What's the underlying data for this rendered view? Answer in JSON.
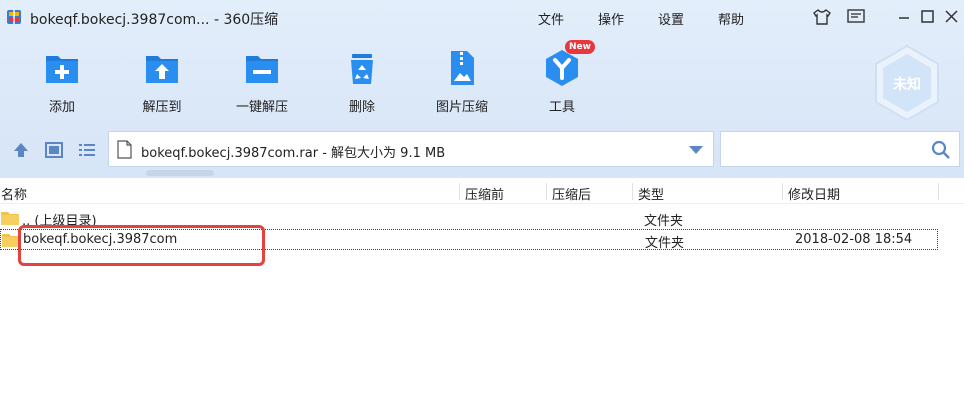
{
  "window": {
    "title": "bokeqf.bokecj.3987com... - 360压缩",
    "menu": [
      "文件",
      "操作",
      "设置",
      "帮助"
    ]
  },
  "toolbar": {
    "items": [
      {
        "label": "添加",
        "icon": "add-icon"
      },
      {
        "label": "解压到",
        "icon": "extract-to-icon"
      },
      {
        "label": "一键解压",
        "icon": "one-click-extract-icon"
      },
      {
        "label": "删除",
        "icon": "delete-icon"
      },
      {
        "label": "图片压缩",
        "icon": "image-compress-icon"
      },
      {
        "label": "工具",
        "icon": "tools-icon"
      }
    ],
    "new_badge": "New",
    "unknown_label": "未知"
  },
  "address": {
    "text": "bokeqf.bokecj.3987com.rar - 解包大小为 9.1 MB",
    "search_placeholder": ""
  },
  "columns": {
    "name": "名称",
    "compressed_before": "压缩前",
    "compressed_after": "压缩后",
    "type": "类型",
    "modified": "修改日期"
  },
  "rows": [
    {
      "name": ".. (上级目录)",
      "type": "文件夹",
      "date": ""
    },
    {
      "name": "bokeqf.bokecj.3987com",
      "type": "文件夹",
      "date": "2018-02-08 18:54"
    }
  ],
  "colors": {
    "accent": "#2a86e0",
    "highlight": "#e5413d",
    "toolbar_bg": "#dbe8f8"
  }
}
